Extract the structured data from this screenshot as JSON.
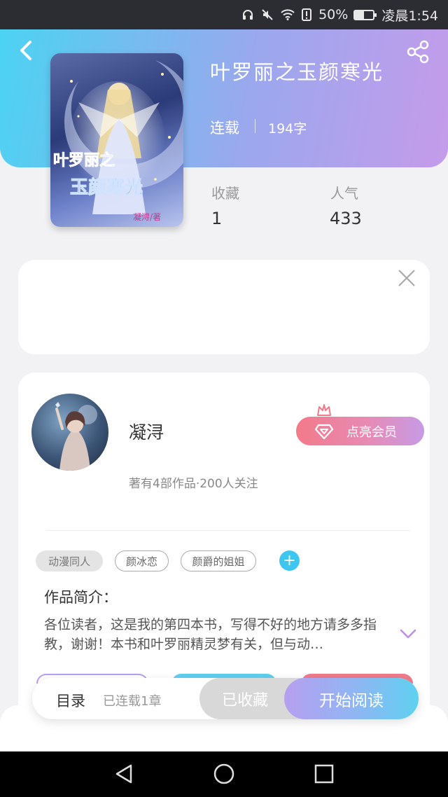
{
  "status_bar": {
    "battery_percent": "50%",
    "battery_level": 0.5,
    "time": "凌晨1:54",
    "icons": [
      "headphone-icon",
      "mute-icon",
      "wifi-icon",
      "alert-icon",
      "battery-icon"
    ]
  },
  "header": {
    "back_icon": "chevron-left-icon",
    "share_icon": "share-icon"
  },
  "book": {
    "title": "叶罗丽之玉颜寒光",
    "status": "连载",
    "word_count": "194字",
    "cover_text_line1": "叶罗丽之",
    "cover_text_line2": "玉颜寒光",
    "cover_author": "凝浔/著"
  },
  "stats": {
    "favorites_label": "收藏",
    "favorites_value": "1",
    "popularity_label": "人气",
    "popularity_value": "433"
  },
  "ad": {
    "close_icon": "close-icon"
  },
  "author": {
    "name": "凝浔",
    "meta": "著有4部作品·200人关注",
    "vip_label": "点亮会员"
  },
  "tags": [
    "动漫同人",
    "颜冰恋",
    "颜爵的姐姐"
  ],
  "tag_add_label": "+",
  "intro": {
    "title": "作品简介：",
    "text": "各位读者，这是我的第四本书，写得不好的地方请多多指教，谢谢！本书和叶罗丽精灵梦有关，但与动…"
  },
  "action_bar": {
    "toc_label": "目录",
    "toc_sub": "已连载1章",
    "favorited_label": "已收藏",
    "read_label": "开始阅读"
  },
  "colors": {
    "header_start": "#4bd3f2",
    "header_end": "#c59bea",
    "tag_add": "#3dc6f0",
    "vip_start": "#f27a8a",
    "vip_end": "#c69be6"
  }
}
